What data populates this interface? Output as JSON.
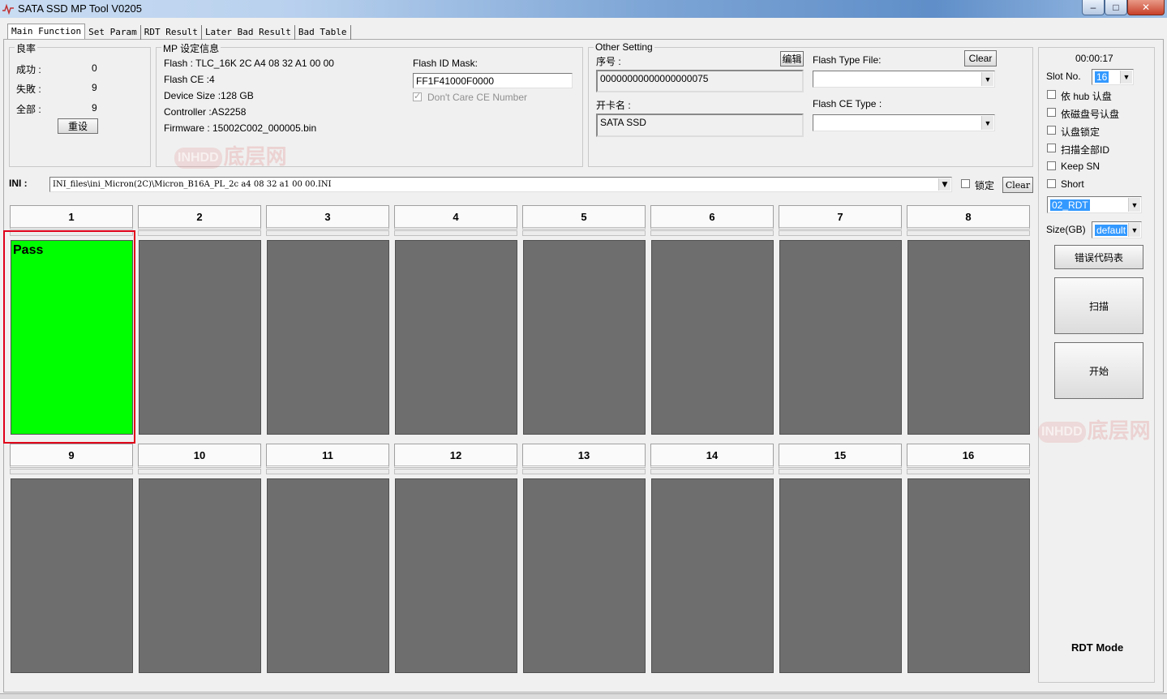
{
  "window": {
    "title": "SATA SSD MP Tool V0205",
    "min": "–",
    "max": "□",
    "close": "✕"
  },
  "tabs": [
    "Main Function",
    "Set Param",
    "RDT Result",
    "Later Bad Result",
    "Bad Table"
  ],
  "yield": {
    "legend": "良率",
    "success_label": "成功 :",
    "success_value": "0",
    "fail_label": "失敗 :",
    "fail_value": "9",
    "total_label": "全部 :",
    "total_value": "9",
    "reset_button": "重设"
  },
  "mp_info": {
    "legend": "MP 设定信息",
    "flash": "Flash : TLC_16K 2C A4 08 32 A1 00 00",
    "flash_ce": "Flash CE :4",
    "device_size": "Device Size :128 GB",
    "controller": "Controller :AS2258",
    "firmware": "Firmware : 15002C002_000005.bin",
    "flash_id_mask_label": "Flash ID Mask:",
    "flash_id_mask_value": "FF1F41000F0000",
    "dont_care_ce": "Don't Care CE Number"
  },
  "other_setting": {
    "legend": "Other Setting",
    "serial_label": "序号 :",
    "edit_button": "编辑",
    "serial_value": "00000000000000000075",
    "card_name_label": "开卡名 :",
    "card_name_value": "SATA SSD",
    "flash_type_file_label": "Flash Type File:",
    "clear_button": "Clear",
    "flash_type_file_value": "",
    "flash_ce_type_label": "Flash CE Type :",
    "flash_ce_type_value": ""
  },
  "ini": {
    "label": "INI :",
    "path": "INI_files\\ini_Micron(2C)\\Micron_B16A_PL_2c a4 08 32 a1 00 00.INI",
    "lock_label": "锁定",
    "clear_button": "Clear"
  },
  "slots": [
    {
      "label": "1",
      "status": "Pass"
    },
    {
      "label": "2",
      "status": ""
    },
    {
      "label": "3",
      "status": ""
    },
    {
      "label": "4",
      "status": ""
    },
    {
      "label": "5",
      "status": ""
    },
    {
      "label": "6",
      "status": ""
    },
    {
      "label": "7",
      "status": ""
    },
    {
      "label": "8",
      "status": ""
    },
    {
      "label": "9",
      "status": ""
    },
    {
      "label": "10",
      "status": ""
    },
    {
      "label": "11",
      "status": ""
    },
    {
      "label": "12",
      "status": ""
    },
    {
      "label": "13",
      "status": ""
    },
    {
      "label": "14",
      "status": ""
    },
    {
      "label": "15",
      "status": ""
    },
    {
      "label": "16",
      "status": ""
    }
  ],
  "right_panel": {
    "timer": "00:00:17",
    "slot_no_label": "Slot No.",
    "slot_no_value": "16",
    "options": [
      "依 hub 认盘",
      "依磁盘号认盘",
      "认盘锁定",
      "扫描全部ID",
      "Keep SN",
      "Short"
    ],
    "mode_select": "02_RDT",
    "size_label": "Size(GB)",
    "size_value": "default",
    "error_code_button": "错误代码表",
    "scan_button": "扫描",
    "start_button": "开始",
    "mode_text": "RDT Mode"
  },
  "watermark": {
    "badge": "INHDD",
    "text": "底层网"
  },
  "colors": {
    "pass": "#00ff00",
    "idle": "#6e6e6e",
    "highlight": "#e0001a",
    "selection": "#3399ff"
  }
}
